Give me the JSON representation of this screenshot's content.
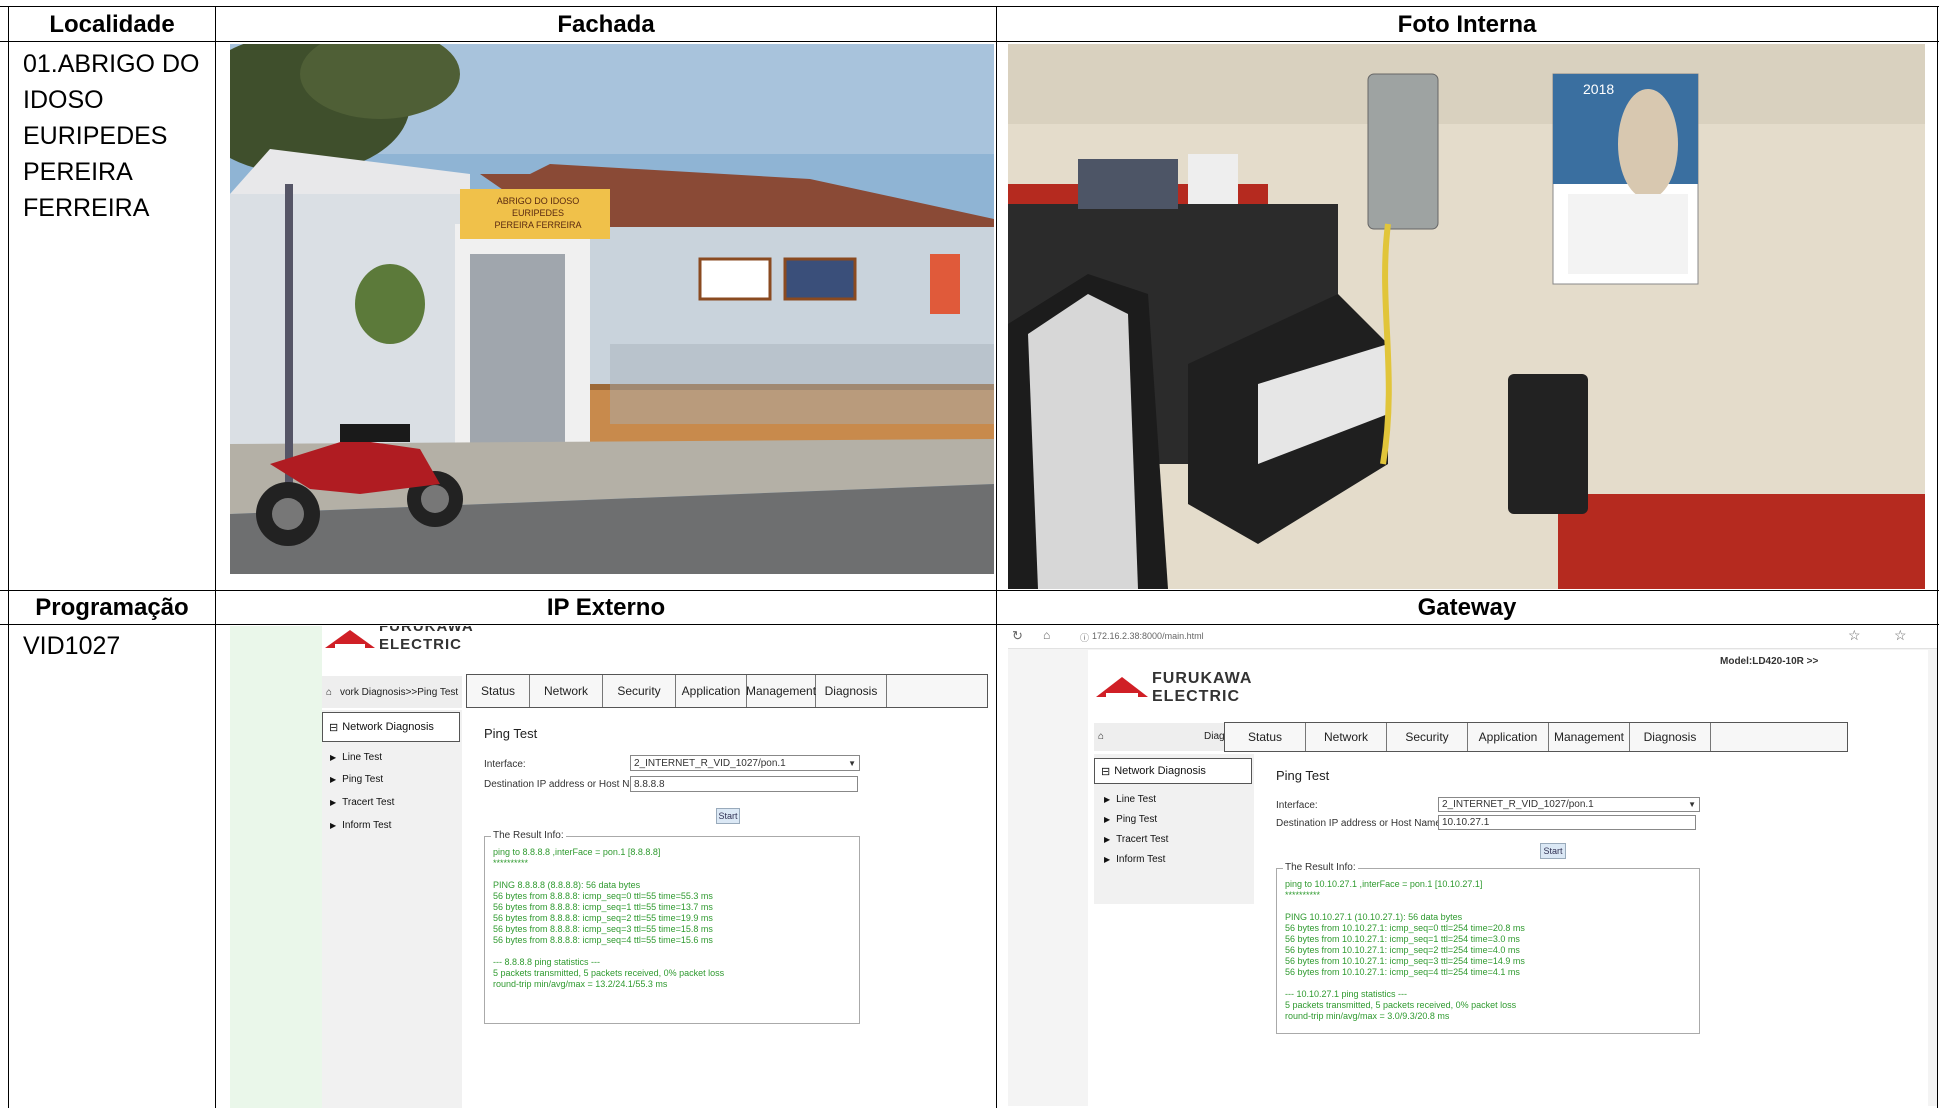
{
  "headers": {
    "localidade": "Localidade",
    "fachada": "Fachada",
    "foto_interna": "Foto Interna",
    "programacao": "Programação",
    "ip_externo": "IP Externo",
    "gateway": "Gateway"
  },
  "localidade_value": [
    "01.ABRIGO DO",
    "IDOSO",
    "EURIPEDES",
    "PEREIRA",
    "FERREIRA"
  ],
  "programacao_value": "VID1027",
  "fachada_sign": [
    "ABRIGO DO IDOSO",
    "EURIPEDES",
    "PEREIRA FERREIRA"
  ],
  "calendar_year": "2018",
  "ip_externo": {
    "logo": [
      "FURUKAWA",
      "ELECTRIC"
    ],
    "breadcrumb": "vork Diagnosis>>Ping Test",
    "menu": [
      "Status",
      "Network",
      "Security",
      "Application",
      "Management",
      "Diagnosis"
    ],
    "side_head": "Network Diagnosis",
    "side_items": [
      "Line Test",
      "Ping Test",
      "Tracert Test",
      "Inform Test"
    ],
    "title": "Ping Test",
    "interface_label": "Interface:",
    "interface_value": "2_INTERNET_R_VID_1027/pon.1",
    "dest_label": "Destination IP address or Host Name:",
    "dest_value": "8.8.8.8",
    "start": "Start",
    "result_legend": "The Result Info:",
    "result_lines": [
      "ping to 8.8.8.8 ,interFace = pon.1 [8.8.8.8]",
      "**********",
      "",
      "PING 8.8.8.8 (8.8.8.8): 56 data bytes",
      "56 bytes from 8.8.8.8: icmp_seq=0 ttl=55 time=55.3 ms",
      "56 bytes from 8.8.8.8: icmp_seq=1 ttl=55 time=13.7 ms",
      "56 bytes from 8.8.8.8: icmp_seq=2 ttl=55 time=19.9 ms",
      "56 bytes from 8.8.8.8: icmp_seq=3 ttl=55 time=15.8 ms",
      "56 bytes from 8.8.8.8: icmp_seq=4 ttl=55 time=15.6 ms",
      "",
      "--- 8.8.8.8 ping statistics ---",
      "5 packets transmitted, 5 packets received, 0% packet loss",
      "round-trip min/avg/max = 13.2/24.1/55.3 ms"
    ]
  },
  "gateway": {
    "url": "172.16.2.38:8000/main.html",
    "model": "Model:LD420-10R >>",
    "logo": [
      "FURUKAWA",
      "ELECTRIC"
    ],
    "crumb": "Diag",
    "menu": [
      "Status",
      "Network",
      "Security",
      "Application",
      "Management",
      "Diagnosis"
    ],
    "side_head": "Network Diagnosis",
    "side_items": [
      "Line Test",
      "Ping Test",
      "Tracert Test",
      "Inform Test"
    ],
    "title": "Ping Test",
    "interface_label": "Interface:",
    "interface_value": "2_INTERNET_R_VID_1027/pon.1",
    "dest_label": "Destination IP address or Host Name:",
    "dest_value": "10.10.27.1",
    "start": "Start",
    "result_legend": "The Result Info:",
    "result_lines": [
      "ping to 10.10.27.1 ,interFace = pon.1 [10.10.27.1]",
      "**********",
      "",
      "PING 10.10.27.1 (10.10.27.1): 56 data bytes",
      "56 bytes from 10.10.27.1: icmp_seq=0 ttl=254 time=20.8 ms",
      "56 bytes from 10.10.27.1: icmp_seq=1 ttl=254 time=3.0 ms",
      "56 bytes from 10.10.27.1: icmp_seq=2 ttl=254 time=4.0 ms",
      "56 bytes from 10.10.27.1: icmp_seq=3 ttl=254 time=14.9 ms",
      "56 bytes from 10.10.27.1: icmp_seq=4 ttl=254 time=4.1 ms",
      "",
      "--- 10.10.27.1 ping statistics ---",
      "5 packets transmitted, 5 packets received, 0% packet loss",
      "round-trip min/avg/max = 3.0/9.3/20.8 ms"
    ]
  },
  "colors": {
    "sky": "#8fb4d4",
    "wall": "#c9d3dc",
    "roof": "#8a4a36",
    "road": "#6e6f70",
    "sidewalk": "#b4b0a6",
    "interior_wall": "#e4dccb",
    "red_stripe": "#b52a1f",
    "ping_green": "#2f9a2f"
  }
}
